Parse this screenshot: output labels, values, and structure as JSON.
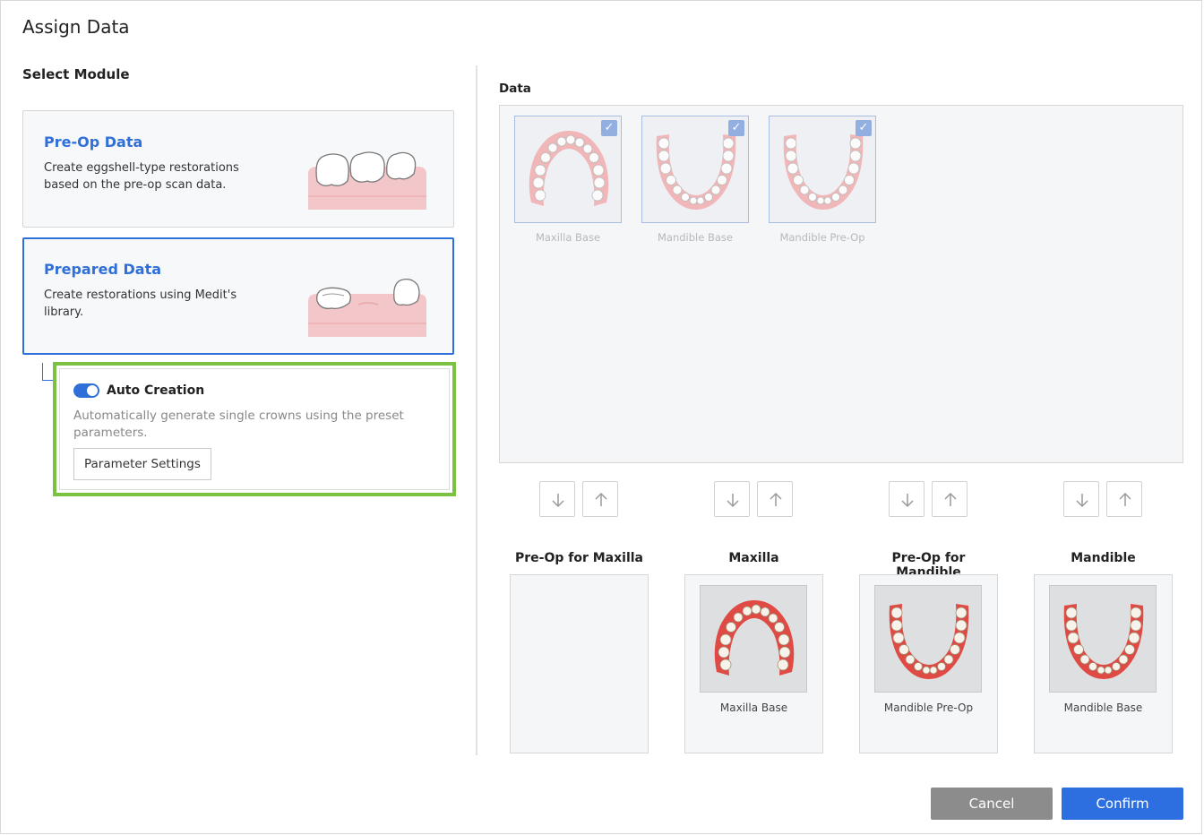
{
  "dialog": {
    "title": "Assign Data"
  },
  "select_module": {
    "label": "Select Module",
    "modules": [
      {
        "title": "Pre-Op Data",
        "description": "Create eggshell-type restorations based on the pre-op scan data.",
        "selected": false
      },
      {
        "title": "Prepared Data",
        "description": "Create restorations using Medit's library.",
        "selected": true
      }
    ],
    "auto_creation": {
      "title": "Auto Creation",
      "enabled": true,
      "description": "Automatically generate single crowns using the preset parameters.",
      "button_label": "Parameter Settings"
    }
  },
  "data_panel": {
    "label": "Data",
    "items": [
      {
        "label": "Maxilla Base",
        "checked": true,
        "arch": "maxilla"
      },
      {
        "label": "Mandible Base",
        "checked": true,
        "arch": "mandible"
      },
      {
        "label": "Mandible Pre-Op",
        "checked": true,
        "arch": "mandible"
      }
    ]
  },
  "slots": [
    {
      "title": "Pre-Op for Maxilla",
      "assigned": ""
    },
    {
      "title": "Maxilla",
      "assigned": "Maxilla Base"
    },
    {
      "title": "Pre-Op for Mandible",
      "assigned": "Mandible Pre-Op"
    },
    {
      "title": "Mandible",
      "assigned": "Mandible Base"
    }
  ],
  "icons": {
    "check": "check-icon",
    "down": "arrow-down-icon",
    "up": "arrow-up-icon",
    "toggle": "toggle-switch"
  },
  "colors": {
    "accent": "#2f6fd8",
    "highlight": "#7cc242",
    "cancel": "#8c8c8c",
    "confirm": "#2d6fe0"
  },
  "footer": {
    "cancel_label": "Cancel",
    "confirm_label": "Confirm"
  }
}
